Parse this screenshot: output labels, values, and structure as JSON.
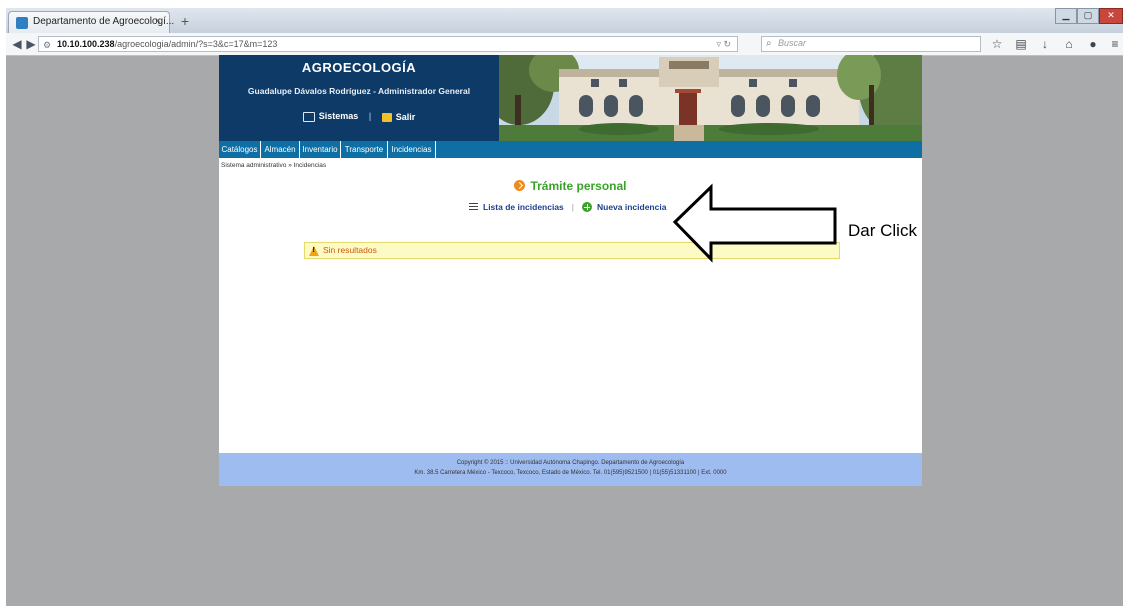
{
  "browser": {
    "tab_title": "Departamento de Agroecologí...",
    "tab_close": "×",
    "new_tab": "+",
    "url_host": "10.10.100.238",
    "url_path": "/agroecologia/admin/?s=3&c=17&m=123",
    "search_placeholder": "Buscar"
  },
  "site": {
    "title": "AGROECOLOGÍA",
    "user_line": "Guadalupe Dávalos Rodríguez - Administrador General",
    "links": {
      "systems": "Sistemas",
      "separator": "|",
      "exit": "Salir"
    },
    "menu": [
      {
        "label": "Catálogos"
      },
      {
        "label": "Almacén"
      },
      {
        "label": "Inventario"
      },
      {
        "label": "Transporte"
      },
      {
        "label": "Incidencias"
      }
    ],
    "breadcrumb": "Sistema administrativo » Incidencias",
    "page_heading": "Trámite personal",
    "actions": {
      "list_label": "Lista de incidencias",
      "separator": "|",
      "new_label": "Nueva incidencia"
    },
    "alert": "Sin resultados",
    "footer": {
      "line1": "Copyright © 2015 :: Universidad Autónoma Chapingo. Departamento de Agroecología",
      "line2": "Km. 38.5 Carretera México - Texcoco, Texcoco, Estado de México. Tel. 01(595)9521500 | 01(55)51331100 | Ext. 0000"
    }
  },
  "annotation": {
    "label": "Dar Click"
  },
  "colors": {
    "header_navy": "#0d3a66",
    "menu_blue": "#0e6fa5",
    "heading_green": "#3aa32a",
    "alert_orange": "#cc5a0a",
    "alert_background": "#fdfbc5",
    "footer_blue": "#9fbcf0",
    "outer_gray": "#a7a9ab"
  },
  "icons": {
    "menu_systems": "monitor-icon",
    "menu_exit": "exit-icon",
    "heading": "arrow-circle-icon",
    "list": "list-icon",
    "new": "plus-circle-icon",
    "alert": "warning-icon"
  }
}
